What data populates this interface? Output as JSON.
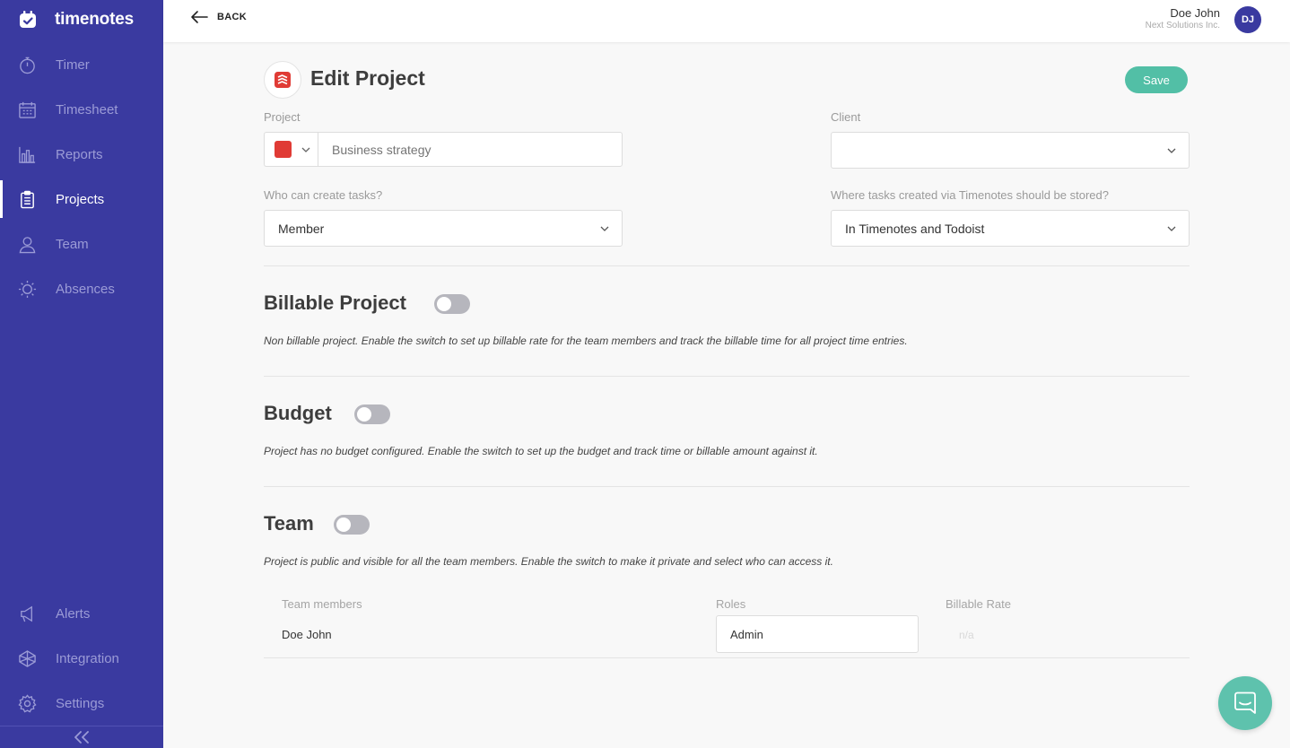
{
  "app": {
    "name": "timenotes"
  },
  "sidebar": {
    "items": [
      {
        "label": "Timer",
        "icon": "stopwatch-icon"
      },
      {
        "label": "Timesheet",
        "icon": "calendar-grid-icon"
      },
      {
        "label": "Reports",
        "icon": "bar-chart-icon"
      },
      {
        "label": "Projects",
        "icon": "clipboard-icon",
        "active": true
      },
      {
        "label": "Team",
        "icon": "user-icon"
      },
      {
        "label": "Absences",
        "icon": "sun-icon"
      }
    ],
    "bottom_items": [
      {
        "label": "Alerts",
        "icon": "megaphone-icon"
      },
      {
        "label": "Integration",
        "icon": "integration-icon"
      },
      {
        "label": "Settings",
        "icon": "gear-icon"
      }
    ]
  },
  "topbar": {
    "back_label": "BACK",
    "user_name": "Doe John",
    "user_company": "Next Solutions Inc.",
    "user_initials": "DJ"
  },
  "page": {
    "title": "Edit Project",
    "save_label": "Save"
  },
  "form": {
    "project_label": "Project",
    "project_color": "#e03b35",
    "project_placeholder": "Business strategy",
    "client_label": "Client",
    "client_value": "",
    "create_tasks_label": "Who can create tasks?",
    "create_tasks_value": "Member",
    "storage_label": "Where tasks created via Timenotes should be stored?",
    "storage_value": "In Timenotes and Todoist"
  },
  "sections": {
    "billable": {
      "title": "Billable Project",
      "enabled": false,
      "desc": "Non billable project. Enable the switch to set up billable rate for the team members and track the billable time for all project time entries."
    },
    "budget": {
      "title": "Budget",
      "enabled": false,
      "desc": "Project has no budget configured. Enable the switch to set up the budget and track time or billable amount against it."
    },
    "team": {
      "title": "Team",
      "enabled": false,
      "desc": "Project is public and visible for all the team members. Enable the switch to make it private and select who can access it."
    }
  },
  "team_table": {
    "columns": [
      "Team members",
      "Roles",
      "Billable Rate"
    ],
    "rows": [
      {
        "member": "Doe John",
        "role": "Admin",
        "rate": "n/a"
      }
    ]
  },
  "colors": {
    "sidebar": "#3a3aa0",
    "accent": "#52bfa6",
    "todoist_red": "#e03b35"
  }
}
